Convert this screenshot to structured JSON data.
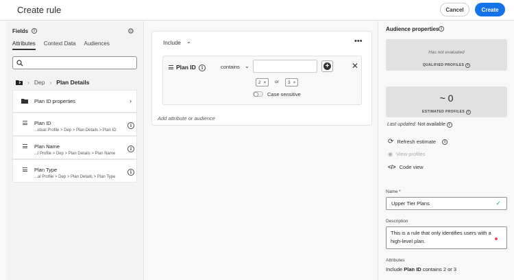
{
  "header": {
    "title": "Create rule",
    "cancel_label": "Cancel",
    "create_label": "Create",
    "accent": "#1473e6"
  },
  "left": {
    "fields_title": "Fields",
    "tabs": [
      {
        "label": "Attributes"
      },
      {
        "label": "Context Data"
      },
      {
        "label": "Audiences"
      }
    ],
    "breadcrumb": {
      "parent": "Dep",
      "current": "Plan Details"
    },
    "folder": {
      "label": "Plan ID properties"
    },
    "fields": [
      {
        "label": "Plan ID",
        "path": "...idual Profile > Dep > Plan Details > Plan ID"
      },
      {
        "label": "Plan Name",
        "path": "...l Profile > Dep > Plan Details > Plan Name"
      },
      {
        "label": "Plan Type",
        "path": "...al Profile > Dep > Plan Details > Plan Type"
      }
    ]
  },
  "rule": {
    "include_label": "Include",
    "field": "Plan ID",
    "operator": "contains",
    "values": [
      "2",
      "3"
    ],
    "or_label": "or",
    "case_sensitive_label": "Case sensitive",
    "add_attribute_label": "Add attribute or audience"
  },
  "audience": {
    "title": "Audience properties",
    "not_evaluated": "Has not evaluated",
    "qualified_label": "QUALIFIED PROFILES",
    "estimate_value": "~ 0",
    "estimated_label": "ESTIMATED PROFILES",
    "last_updated_label": "Last updated:",
    "last_updated_value": "Not available",
    "refresh_label": "Refresh estimate",
    "view_profiles_label": "View profiles",
    "code_view_label": "Code view",
    "name_label": "Name *",
    "name_value": "Upper Tier Plans",
    "description_label": "Description",
    "description_value": "This is a rule that only identifies users with a high-level plan.",
    "attributes_label": "Attributes",
    "attributes_prefix": "Include",
    "attributes_field": "Plan ID",
    "attributes_suffix": "contains 2 or 3"
  }
}
